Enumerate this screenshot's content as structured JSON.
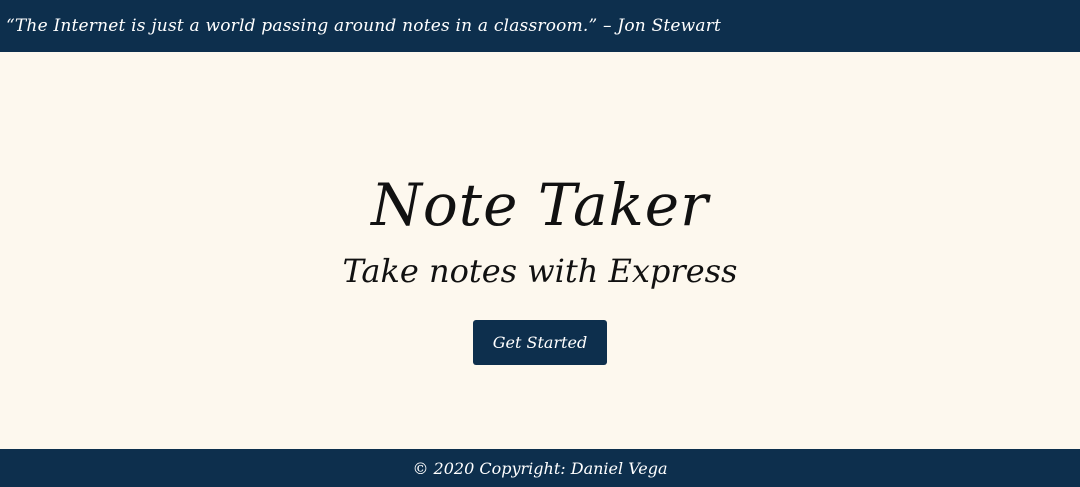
{
  "header": {
    "quote": "“The Internet is just a world passing around notes in a classroom.” – Jon Stewart"
  },
  "hero": {
    "title": "Note Taker",
    "subtitle": "Take notes with Express",
    "cta_label": "Get Started"
  },
  "footer": {
    "copyright": "© 2020 Copyright: Daniel Vega"
  },
  "colors": {
    "navy": "#0d2f4d",
    "background": "#fdf8ee",
    "text": "#111111"
  }
}
